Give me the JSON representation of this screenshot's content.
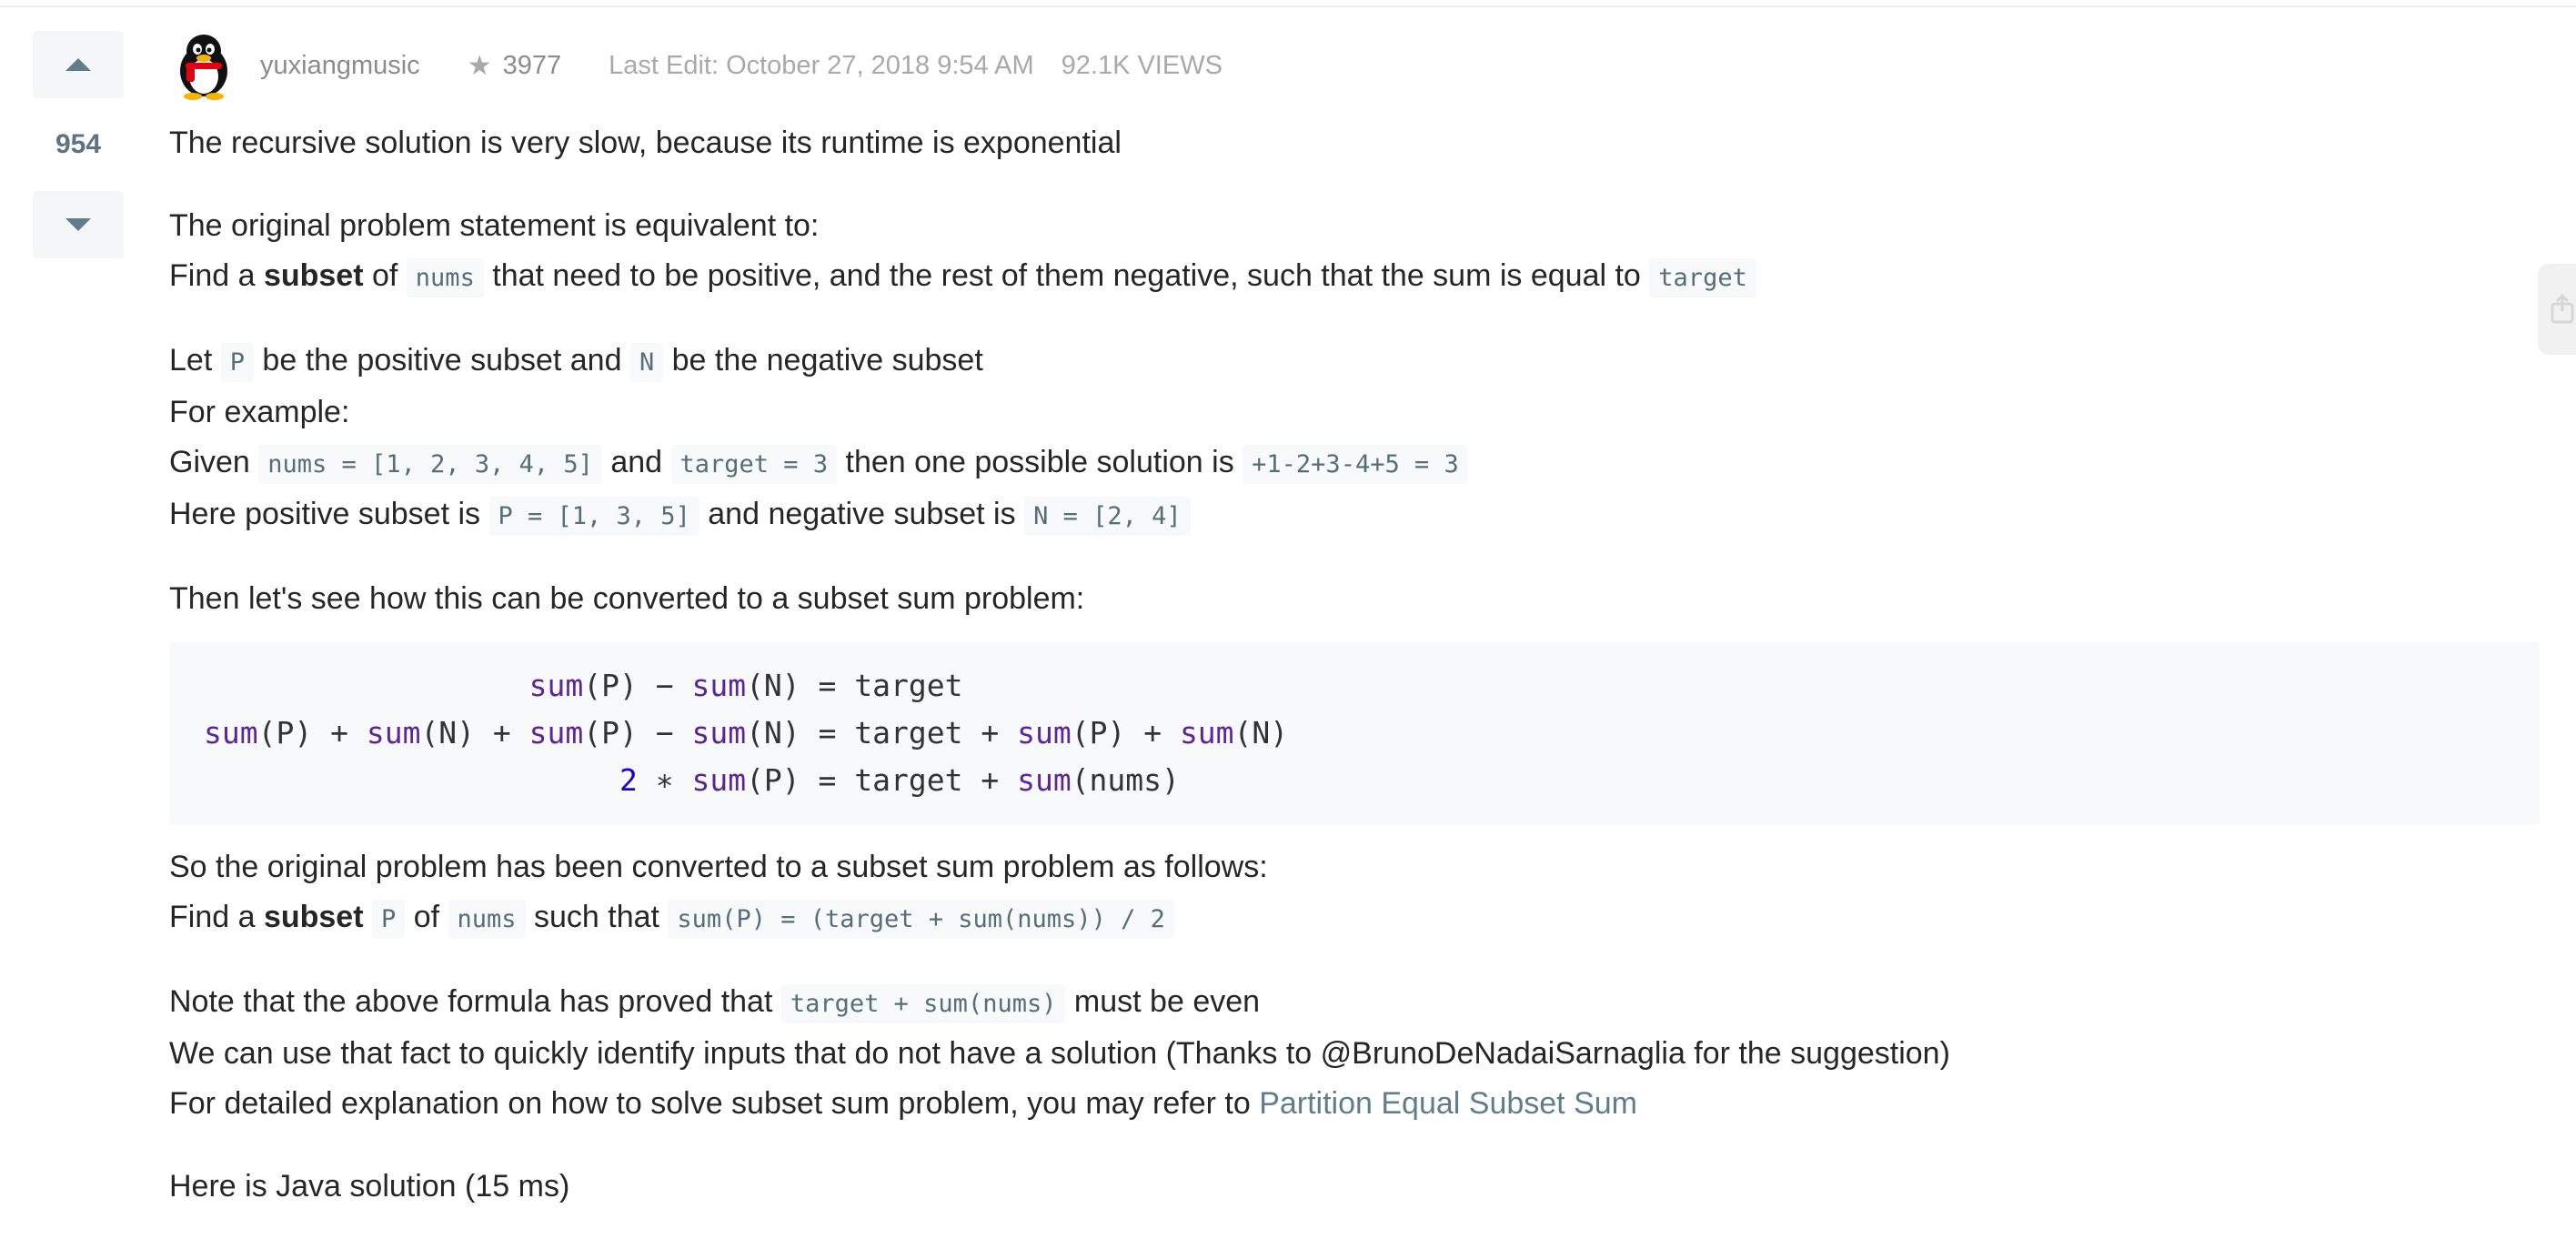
{
  "post": {
    "votes": "954",
    "author": "yuxiangmusic",
    "reputation": "3977",
    "last_edit": "Last Edit: October 27, 2018 9:54 AM",
    "views": "92.1K VIEWS"
  },
  "body": {
    "p1": "The recursive solution is very slow, because its runtime is exponential",
    "p2_line1": "The original problem statement is equivalent to:",
    "p2_find": "Find a ",
    "p2_subset": "subset",
    "p2_of": " of ",
    "p2_nums": "nums",
    "p2_rest": " that need to be positive, and the rest of them negative, such that the sum is equal to ",
    "p2_target": "target",
    "p3_let": "Let ",
    "p3_P": "P",
    "p3_mid": " be the positive subset and ",
    "p3_N": "N",
    "p3_end": " be the negative subset",
    "p3_example": "For example:",
    "p3_given": "Given ",
    "p3_nums_val": "nums = [1, 2, 3, 4, 5]",
    "p3_and": " and ",
    "p3_target_val": "target = 3",
    "p3_then": " then one possible solution is ",
    "p3_solution": "+1-2+3-4+5 = 3",
    "p3_here": "Here positive subset is ",
    "p3_P_val": "P = [1, 3, 5]",
    "p3_neg": " and negative subset is ",
    "p3_N_val": "N = [2, 4]",
    "p4": "Then let's see how this can be converted to a subset sum problem:",
    "p5_line1": "So the original problem has been converted to a subset sum problem as follows:",
    "p5_find": "Find a ",
    "p5_subset": "subset",
    "p5_P": "P",
    "p5_of": " of ",
    "p5_nums": "nums",
    "p5_such": " such that ",
    "p5_formula": "sum(P) = (target + sum(nums)) / 2",
    "p6_note": "Note that the above formula has proved that ",
    "p6_expr": "target + sum(nums)",
    "p6_even": " must be even",
    "p6_line2": "We can use that fact to quickly identify inputs that do not have a solution (Thanks to @BrunoDeNadaiSarnaglia for the suggestion)",
    "p6_line3": "For detailed explanation on how to solve subset sum problem, you may refer to ",
    "p6_link": "Partition Equal Subset Sum",
    "p7": "Here is Java solution (15 ms)"
  },
  "code": {
    "line1_pre": "                  ",
    "line1_a": "sum",
    "line1_b": "(P) − ",
    "line1_c": "sum",
    "line1_d": "(N) = target",
    "line2_a": "sum",
    "line2_b": "(P) + ",
    "line2_c": "sum",
    "line2_d": "(N) + ",
    "line2_e": "sum",
    "line2_f": "(P) − ",
    "line2_g": "sum",
    "line2_h": "(N) = target + ",
    "line2_i": "sum",
    "line2_j": "(P) + ",
    "line2_k": "sum",
    "line2_l": "(N)",
    "line3_pre": "                       ",
    "line3_num": "2",
    "line3_b": " ∗ ",
    "line3_c": "sum",
    "line3_d": "(P) = target + ",
    "line3_e": "sum",
    "line3_f": "(nums)"
  },
  "colors": {
    "link": "#607d8b",
    "code_fn": "#5c2699",
    "code_num": "#1c00cf",
    "vote_arrow": "#607d8b"
  },
  "icons": {
    "upvote": "triangle-up-icon",
    "downvote": "triangle-down-icon",
    "star": "star-icon",
    "avatar": "penguin-avatar",
    "share": "share-icon"
  }
}
